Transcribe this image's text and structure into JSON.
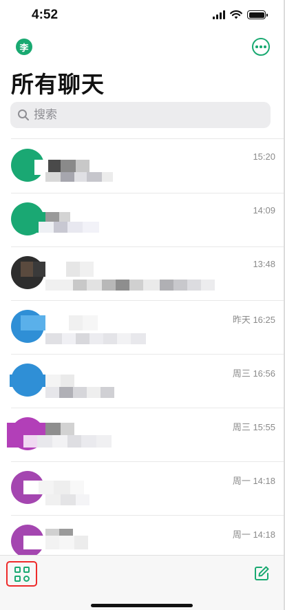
{
  "status_bar": {
    "time": "4:52"
  },
  "header": {
    "avatar_text": "李",
    "title": "所有聊天"
  },
  "search": {
    "placeholder": "搜索"
  },
  "colors": {
    "accent": "#19a971",
    "highlight_box": "#ee2a2a"
  },
  "chats": [
    {
      "time": "15:20",
      "avatar_color": "#1aa873"
    },
    {
      "time": "14:09",
      "avatar_color": "#1aa873"
    },
    {
      "time": "13:48",
      "avatar_color": "#2d2d2d"
    },
    {
      "time": "昨天 16:25",
      "avatar_color": "#2f8fd6"
    },
    {
      "time": "周三 16:56",
      "avatar_color": "#2f8fd6"
    },
    {
      "time": "周三 15:55",
      "avatar_color": "#b23fb8"
    },
    {
      "time": "周一 14:18",
      "avatar_color": "#a446b0"
    },
    {
      "time": "周一 14:18",
      "avatar_color": "#a446b0"
    }
  ],
  "tabbar": {
    "left_icon": "apps-grid-icon",
    "right_icon": "compose-icon"
  }
}
